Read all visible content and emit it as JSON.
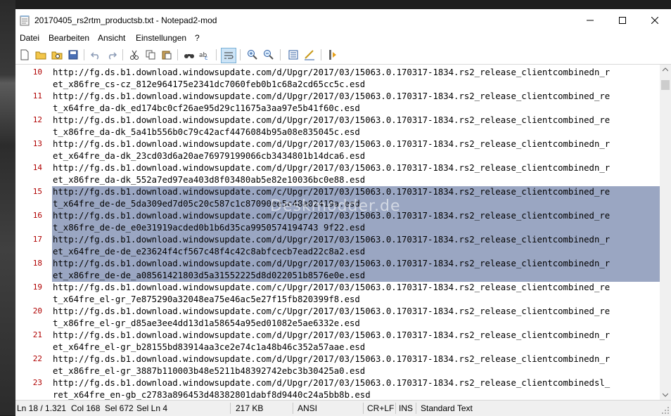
{
  "window": {
    "title": "20170405_rs2rtm_productsb.txt - Notepad2-mod",
    "minimize": "─",
    "maximize": "☐",
    "close": "✕"
  },
  "menu": [
    "Datei",
    "Bearbeiten",
    "Ansicht",
    "Einstellungen",
    "?"
  ],
  "editor": {
    "lines": [
      {
        "num": "10",
        "l1": "http://fg.ds.b1.download.windowsupdate.com/d/Upgr/2017/03/15063.0.170317-1834.rs2_release_clientcombinedn_r",
        "l2": "et_x86fre_cs-cz_812e964175e2341dc7060feb0b1c68a2cd65cc5c.esd",
        "selected": false
      },
      {
        "num": "11",
        "l1": "http://fg.ds.b1.download.windowsupdate.com/d/Upgr/2017/03/15063.0.170317-1834.rs2_release_clientcombined_re",
        "l2": "t_x64fre_da-dk_ed174bc0cf26ae95d29c11675a3aa97e5b41f60c.esd",
        "selected": false
      },
      {
        "num": "12",
        "l1": "http://fg.ds.b1.download.windowsupdate.com/d/Upgr/2017/03/15063.0.170317-1834.rs2_release_clientcombined_re",
        "l2": "t_x86fre_da-dk_5a41b556b0c79c42acf4476084b95a08e835045c.esd",
        "selected": false
      },
      {
        "num": "13",
        "l1": "http://fg.ds.b1.download.windowsupdate.com/d/Upgr/2017/03/15063.0.170317-1834.rs2_release_clientcombinedn_r",
        "l2": "et_x64fre_da-dk_23cd03d6a20ae76979199066cb3434801b14dca6.esd",
        "selected": false
      },
      {
        "num": "14",
        "l1": "http://fg.ds.b1.download.windowsupdate.com/d/Upgr/2017/03/15063.0.170317-1834.rs2_release_clientcombinedn_r",
        "l2": "et_x86fre_da-dk_552a7ed97ea403d8f03480ab5e82e10036bc0e88.esd",
        "selected": false
      },
      {
        "num": "15",
        "l1": "http://fg.ds.b1.download.windowsupdate.com/c/Upgr/2017/03/15063.0.170317-1834.rs2_release_clientcombined_re",
        "l2": "t_x64fre_de-de_5da309ed7d05c20c587c1c87090ee5c48a02419a.esd",
        "selected": true
      },
      {
        "num": "16",
        "l1": "http://fg.ds.b1.download.windowsupdate.com/c/Upgr/2017/03/15063.0.170317-1834.rs2_release_clientcombined_re",
        "l2": "t_x86fre_de-de_e0e31919acded0b1b6d35ca9950574194743 9f22.esd",
        "selected": true
      },
      {
        "num": "17",
        "l1": "http://fg.ds.b1.download.windowsupdate.com/d/Upgr/2017/03/15063.0.170317-1834.rs2_release_clientcombinedn_r",
        "l2": "et_x64fre_de-de_e23624f4cf567c48f4c42c8abfcecb7ead22c8a2.esd",
        "selected": true
      },
      {
        "num": "18",
        "l1": "http://fg.ds.b1.download.windowsupdate.com/d/Upgr/2017/03/15063.0.170317-1834.rs2_release_clientcombinedn_r",
        "l2": "et_x86fre_de-de_a08561421803d5a31552225d8d022051b8576e0e.esd",
        "selected": true
      },
      {
        "num": "19",
        "l1": "http://fg.ds.b1.download.windowsupdate.com/c/Upgr/2017/03/15063.0.170317-1834.rs2_release_clientcombined_re",
        "l2": "t_x64fre_el-gr_7e875290a32048ea75e46ac5e27f15fb820399f8.esd",
        "selected": false
      },
      {
        "num": "20",
        "l1": "http://fg.ds.b1.download.windowsupdate.com/c/Upgr/2017/03/15063.0.170317-1834.rs2_release_clientcombined_re",
        "l2": "t_x86fre_el-gr_d85ae3ee4dd13d1a58654a95ed01082e5ae6332e.esd",
        "selected": false
      },
      {
        "num": "21",
        "l1": "http://fg.ds.b1.download.windowsupdate.com/d/Upgr/2017/03/15063.0.170317-1834.rs2_release_clientcombinedn_r",
        "l2": "et_x64fre_el-gr_b28155bd83914aa3ce2e74c1a48b46c352a57aae.esd",
        "selected": false
      },
      {
        "num": "22",
        "l1": "http://fg.ds.b1.download.windowsupdate.com/d/Upgr/2017/03/15063.0.170317-1834.rs2_release_clientcombinedn_r",
        "l2": "et_x86fre_el-gr_3887b110003b48e5211b48392742ebc3b30425a0.esd",
        "selected": false
      },
      {
        "num": "23",
        "l1": "http://fg.ds.b1.download.windowsupdate.com/d/Upgr/2017/03/15063.0.170317-1834.rs2_release_clientcombinedsl_",
        "l2": "ret_x64fre_en-gb_c2783a896453d48382801dabf8d9440c24a5bb8b.esd",
        "selected": false
      }
    ],
    "selection_color": "#9aa6c2",
    "line_number_color": "#b00000"
  },
  "watermark": "Deskmodder.de",
  "status": {
    "position": "Ln 18 / 1.321",
    "column": "Col 168",
    "selection": "Sel 672",
    "sel_lines": "Sel Ln 4",
    "size": "217 KB",
    "encoding": "ANSI",
    "line_ending": "CR+LF",
    "insert_mode": "INS",
    "scheme": "Standard Text"
  },
  "toolbar_icons": [
    "new-file-icon",
    "open-file-icon",
    "browse-icon",
    "save-icon",
    "undo-icon",
    "redo-icon",
    "cut-icon",
    "copy-icon",
    "paste-icon",
    "find-icon",
    "replace-icon",
    "word-wrap-icon",
    "zoom-in-icon",
    "zoom-out-icon",
    "scheme-icon",
    "customize-icon",
    "exit-icon"
  ]
}
